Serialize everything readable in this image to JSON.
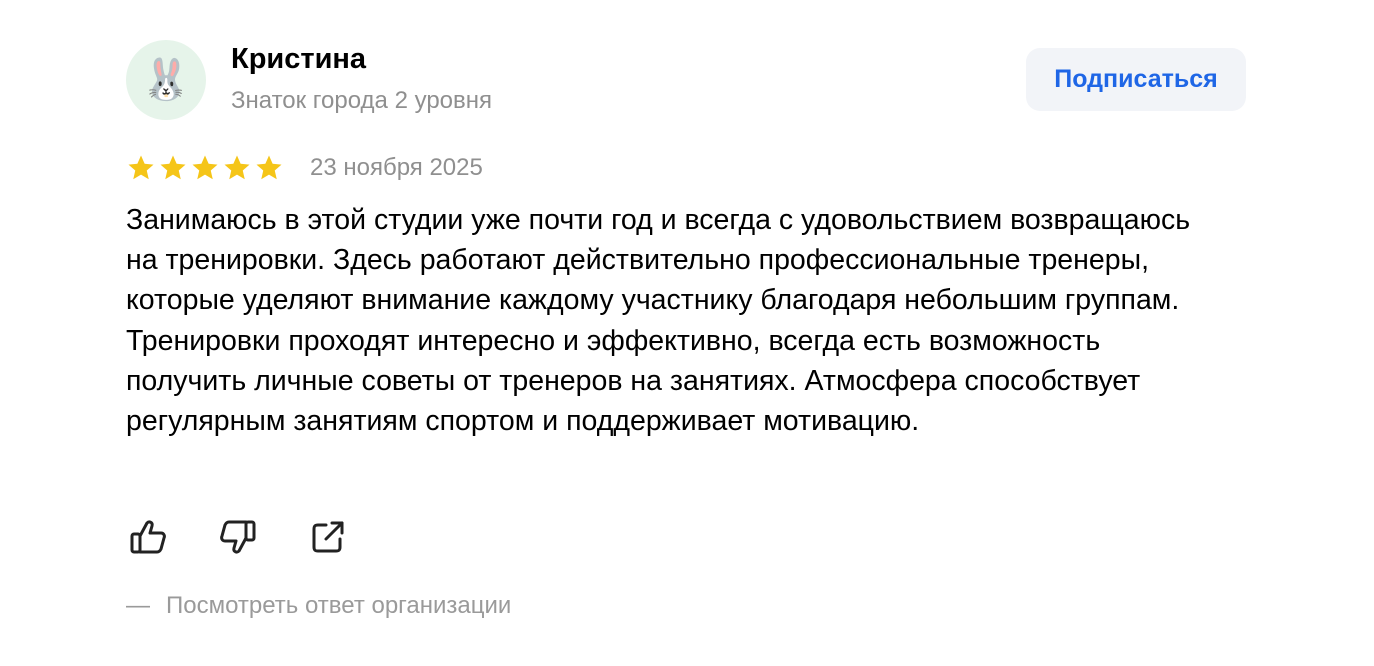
{
  "review": {
    "author": {
      "name": "Кристина",
      "level": "Знаток города 2 уровня",
      "avatar_emoji": "🐰"
    },
    "subscribe_label": "Подписаться",
    "rating": 5,
    "rating_max": 5,
    "date": "23 ноября 2025",
    "text": "Занимаюсь в этой студии уже почти год и всегда с удовольствием возвращаюсь на тренировки. Здесь работают действительно профессиональные тренеры, которые уделяют внимание каждому участнику благодаря небольшим группам. Тренировки проходят интересно и эффективно, всегда есть возможность получить личные советы от тренеров на занятиях. Атмосфера способствует регулярным занятиям спортом и поддерживает мотивацию.",
    "actions": {
      "like_icon": "thumbs-up-icon",
      "dislike_icon": "thumbs-down-icon",
      "share_icon": "share-icon"
    },
    "org_reply": {
      "dash": "—",
      "label": "Посмотреть ответ организации"
    }
  },
  "colors": {
    "star": "#f5c518",
    "accent": "#1f66e6",
    "muted": "#8f8f8f",
    "button_bg": "#f2f4f8",
    "avatar_bg": "#e6f4ea"
  }
}
